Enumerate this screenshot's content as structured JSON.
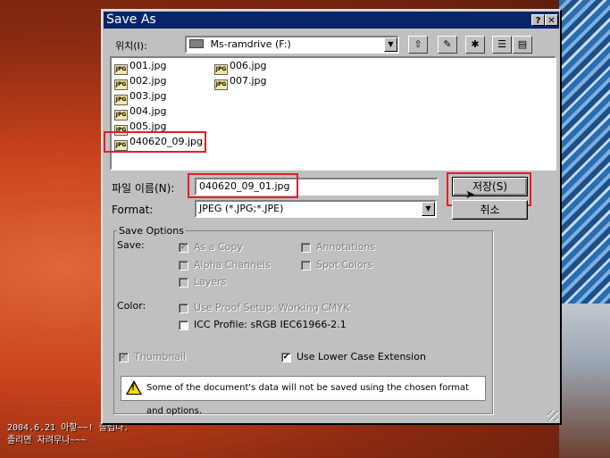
{
  "window": {
    "title": "Save As",
    "help_label": "?",
    "close_label": "✕"
  },
  "location": {
    "label": "위치(I):",
    "value": "Ms-ramdrive (F:)",
    "icon": "drive-icon"
  },
  "toolbar": {
    "up_icon": "⇧",
    "desktop_icon": "✎",
    "new_folder_icon": "✱",
    "list_icon": "☰",
    "details_icon": "▤"
  },
  "files": {
    "col1": [
      "001.jpg",
      "002.jpg",
      "003.jpg",
      "004.jpg",
      "005.jpg",
      "040620_09.jpg"
    ],
    "col2": [
      "006.jpg",
      "007.jpg"
    ],
    "icon_text": "JPG"
  },
  "filename": {
    "label": "파일 이름(N):",
    "value": "040620_09_01.jpg"
  },
  "format": {
    "label": "Format:",
    "value": "JPEG (*.JPG;*.JPE)"
  },
  "buttons": {
    "save": "저장(S)",
    "cancel": "취소"
  },
  "options": {
    "legend": "Save Options",
    "save_label": "Save:",
    "as_copy": "As a Copy",
    "annotations": "Annotations",
    "alpha": "Alpha Channels",
    "spot": "Spot Colors",
    "layers": "Layers",
    "color_label": "Color:",
    "proof": "Use Proof Setup:  Working CMYK",
    "icc": "ICC Profile:  sRGB IEC61966-2.1",
    "thumbnail": "Thumbnail",
    "lowercase": "Use Lower Case Extension",
    "warning": "Some of the document's data will not be saved using the chosen format and options.",
    "check": "✔"
  },
  "caption": {
    "line1": "2004.6.21 아핳~~! 졸립다.",
    "line2": "졸리면 자려무나~~~"
  }
}
